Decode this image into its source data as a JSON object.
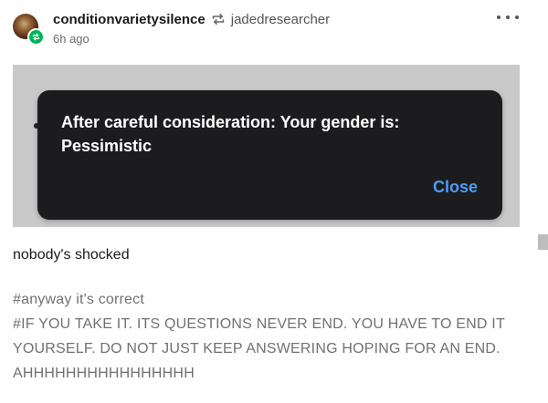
{
  "post": {
    "username": "conditionvarietysilence",
    "reblogged_from": "jadedresearcher",
    "time": "6h ago",
    "more_icon": "more-horizontal-icon",
    "avatar_badge_icon": "reblog-icon",
    "badge_color": "#00b359"
  },
  "image": {
    "dialog": {
      "message": "After careful consideration: Your gender is: Pessimistic",
      "close_label": "Close",
      "background_color": "#1c1c1e",
      "button_color": "#4d9df8"
    }
  },
  "body": {
    "text": "nobody's shocked"
  },
  "tags": [
    "#anyway it's correct",
    "#IF YOU TAKE IT. ITS QUESTIONS NEVER END. YOU HAVE TO END IT YOURSELF. DO NOT JUST KEEP ANSWERING HOPING FOR AN END. AHHHHHHHHHHHHHHHH"
  ]
}
